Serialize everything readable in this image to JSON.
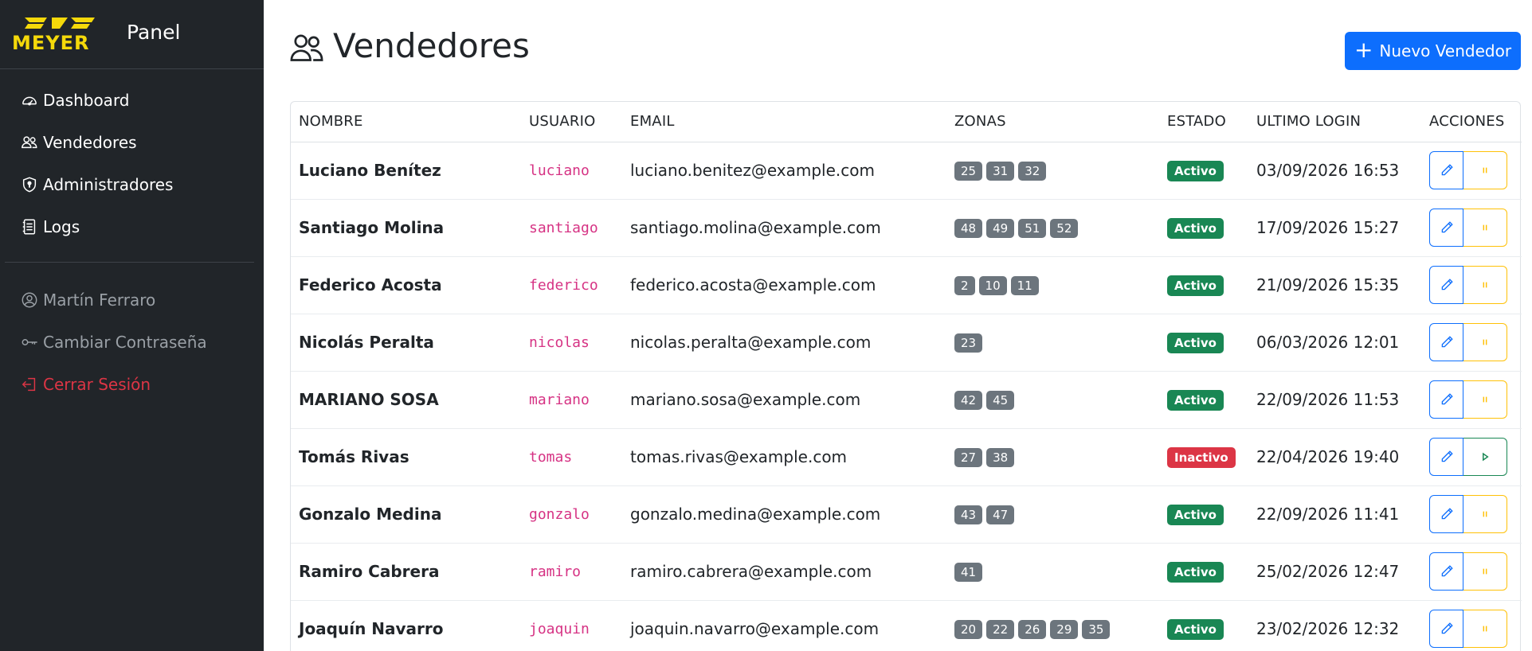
{
  "brand": {
    "text": "Panel"
  },
  "sidebar": {
    "items": [
      {
        "label": "Dashboard",
        "icon": "speedometer-icon"
      },
      {
        "label": "Vendedores",
        "icon": "people-icon"
      },
      {
        "label": "Administradores",
        "icon": "shield-icon"
      },
      {
        "label": "Logs",
        "icon": "journal-icon"
      }
    ],
    "user": {
      "label": "Martín Ferraro",
      "icon": "user-circle-icon"
    },
    "change_password": {
      "label": "Cambiar Contraseña",
      "icon": "key-icon"
    },
    "logout": {
      "label": "Cerrar Sesión",
      "icon": "logout-icon"
    }
  },
  "page": {
    "title": "Vendedores",
    "new_button": "Nuevo Vendedor"
  },
  "table": {
    "headers": [
      "NOMBRE",
      "USUARIO",
      "EMAIL",
      "ZONAS",
      "ESTADO",
      "ULTIMO LOGIN",
      "ACCIONES"
    ],
    "rows": [
      {
        "name": "Luciano Benítez",
        "user": "luciano",
        "email": "luciano.benitez@example.com",
        "zones": [
          "25",
          "31",
          "32"
        ],
        "status": "Activo",
        "active": true,
        "last_login": "03/09/2026 16:53"
      },
      {
        "name": "Santiago Molina",
        "user": "santiago",
        "email": "santiago.molina@example.com",
        "zones": [
          "48",
          "49",
          "51",
          "52"
        ],
        "status": "Activo",
        "active": true,
        "last_login": "17/09/2026 15:27"
      },
      {
        "name": "Federico Acosta",
        "user": "federico",
        "email": "federico.acosta@example.com",
        "zones": [
          "2",
          "10",
          "11"
        ],
        "status": "Activo",
        "active": true,
        "last_login": "21/09/2026 15:35"
      },
      {
        "name": "Nicolás Peralta",
        "user": "nicolas",
        "email": "nicolas.peralta@example.com",
        "zones": [
          "23"
        ],
        "status": "Activo",
        "active": true,
        "last_login": "06/03/2026 12:01"
      },
      {
        "name": "MARIANO SOSA",
        "user": "mariano",
        "email": "mariano.sosa@example.com",
        "zones": [
          "42",
          "45"
        ],
        "status": "Activo",
        "active": true,
        "last_login": "22/09/2026 11:53"
      },
      {
        "name": "Tomás Rivas",
        "user": "tomas",
        "email": "tomas.rivas@example.com",
        "zones": [
          "27",
          "38"
        ],
        "status": "Inactivo",
        "active": false,
        "last_login": "22/04/2026 19:40"
      },
      {
        "name": "Gonzalo Medina",
        "user": "gonzalo",
        "email": "gonzalo.medina@example.com",
        "zones": [
          "43",
          "47"
        ],
        "status": "Activo",
        "active": true,
        "last_login": "22/09/2026 11:41"
      },
      {
        "name": "Ramiro Cabrera",
        "user": "ramiro",
        "email": "ramiro.cabrera@example.com",
        "zones": [
          "41"
        ],
        "status": "Activo",
        "active": true,
        "last_login": "25/02/2026 12:47"
      },
      {
        "name": "Joaquín Navarro",
        "user": "joaquin",
        "email": "joaquin.navarro@example.com",
        "zones": [
          "20",
          "22",
          "26",
          "29",
          "35"
        ],
        "status": "Activo",
        "active": true,
        "last_login": "23/02/2026 12:32"
      }
    ]
  },
  "colors": {
    "sidebar_bg": "#212529",
    "primary": "#0d6efd",
    "success": "#198754",
    "danger": "#dc3545",
    "warning": "#ffc107",
    "zone_badge": "#6c757d",
    "username": "#d63384",
    "logo_yellow": "#f5d90a"
  }
}
